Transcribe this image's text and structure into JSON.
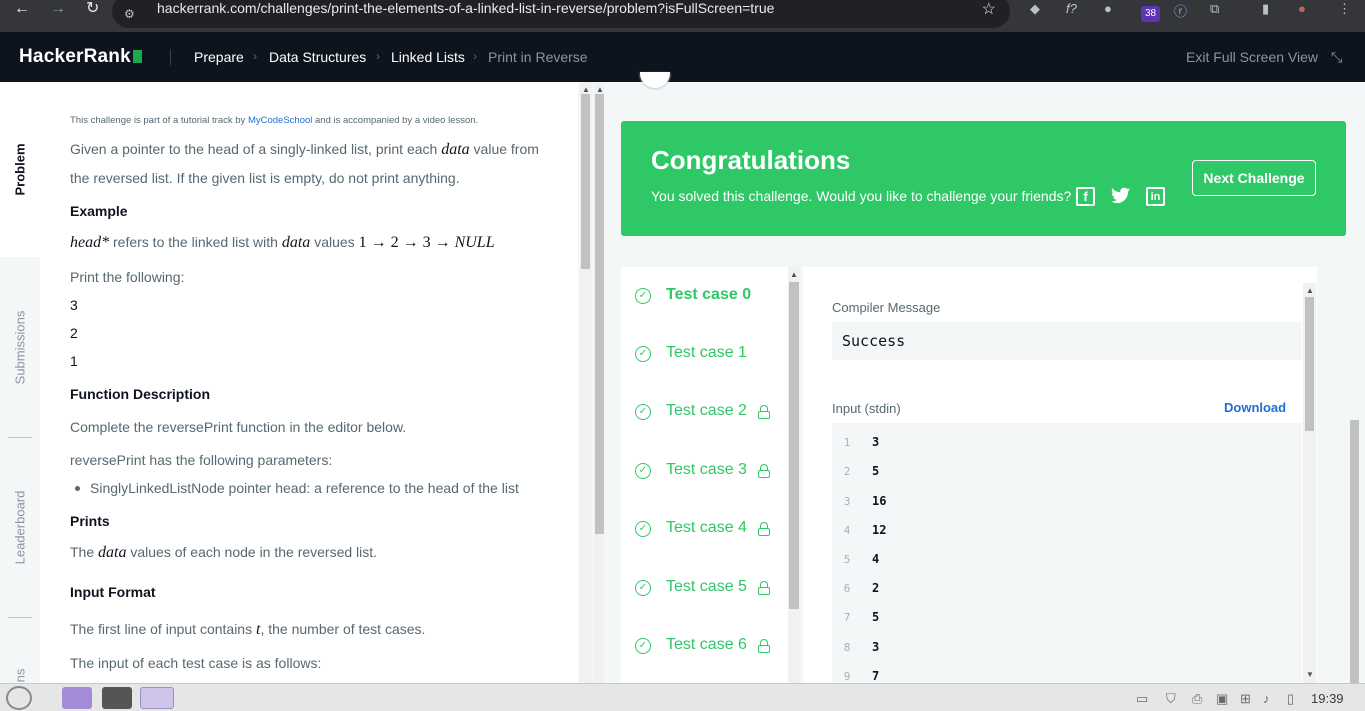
{
  "browser": {
    "url": "hackerrank.com/challenges/print-the-elements-of-a-linked-list-in-reverse/problem?isFullScreen=true",
    "ext_badge": "38",
    "back_icon": "arrow-left-icon",
    "forward_icon": "arrow-right-icon",
    "reload_icon": "reload-icon",
    "star_icon": "star-icon"
  },
  "header": {
    "logo": "HackerRank",
    "breadcrumbs": [
      "Prepare",
      "Data Structures",
      "Linked Lists",
      "Print in Reverse"
    ],
    "exit_full_screen": "Exit Full Screen View"
  },
  "side_tabs": [
    "Problem",
    "Submissions",
    "Leaderboard",
    "ns"
  ],
  "problem": {
    "tutorial_prefix": "This challenge is part of a tutorial track by ",
    "tutorial_link": "MyCodeSchool",
    "tutorial_suffix": " and is accompanied by a video lesson.",
    "intro_1a": "Given a pointer to the head of a singly-linked list, print each ",
    "intro_1_math": "data",
    "intro_1b": " value from",
    "intro_2": "the reversed list. If the given list is empty, do not print anything.",
    "example_heading": "Example",
    "example_math_head": "head*",
    "example_text_a": " refers to the linked list with ",
    "example_math_data": "data",
    "example_text_b": " values ",
    "example_math_list": "1 → 2 → 3 → ",
    "example_math_null": "NULL",
    "print_following": "Print the following:",
    "outputs": [
      "3",
      "2",
      "1"
    ],
    "func_heading": "Function Description",
    "func_text": "Complete the reversePrint function in the editor below.",
    "params_text": "reversePrint has the following parameters:",
    "param_item": "SinglyLinkedListNode pointer head: a reference to the head of the list",
    "prints_heading": "Prints",
    "prints_text_a": "The ",
    "prints_math": "data",
    "prints_text_b": " values of each node in the reversed list.",
    "input_heading": "Input Format",
    "input_text_a": "The first line of input contains ",
    "input_math": "t",
    "input_text_b": ", the number of test cases.",
    "input_text_2": "The input of each test case is as follows:"
  },
  "congrats": {
    "title": "Congratulations",
    "message": "You solved this challenge. Would you like to challenge your friends?",
    "next_button": "Next Challenge",
    "share_icons": [
      "facebook-icon",
      "twitter-icon",
      "linkedin-icon"
    ]
  },
  "test_cases": [
    {
      "label": "Test case 0",
      "locked": false,
      "active": true
    },
    {
      "label": "Test case 1",
      "locked": false,
      "active": false
    },
    {
      "label": "Test case 2",
      "locked": true,
      "active": false
    },
    {
      "label": "Test case 3",
      "locked": true,
      "active": false
    },
    {
      "label": "Test case 4",
      "locked": true,
      "active": false
    },
    {
      "label": "Test case 5",
      "locked": true,
      "active": false
    },
    {
      "label": "Test case 6",
      "locked": true,
      "active": false
    }
  ],
  "output": {
    "compiler_label": "Compiler Message",
    "compiler_message": "Success",
    "input_label": "Input (stdin)",
    "download": "Download",
    "input_lines": [
      {
        "n": "1",
        "v": "3"
      },
      {
        "n": "2",
        "v": "5"
      },
      {
        "n": "3",
        "v": "16"
      },
      {
        "n": "4",
        "v": "12"
      },
      {
        "n": "5",
        "v": "4"
      },
      {
        "n": "6",
        "v": "2"
      },
      {
        "n": "7",
        "v": "5"
      },
      {
        "n": "8",
        "v": "3"
      },
      {
        "n": "9",
        "v": "7"
      }
    ]
  },
  "taskbar": {
    "clock": "19:39"
  },
  "colors": {
    "header_bg": "#0e141e",
    "success_green": "#2ec866",
    "link_blue": "#1f6fd6"
  }
}
